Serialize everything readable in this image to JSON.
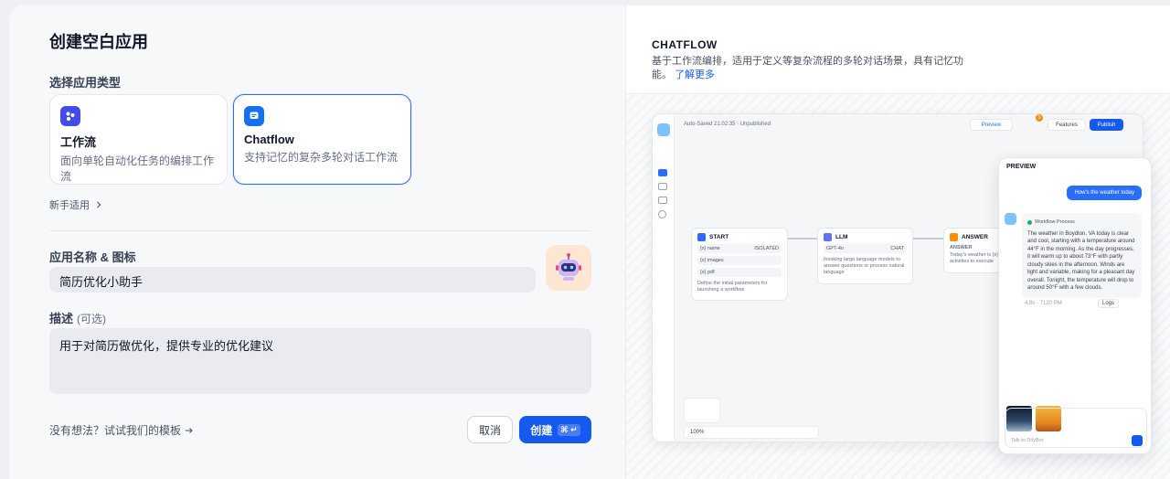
{
  "dialog": {
    "title": "创建空白应用",
    "type_label": "选择应用类型",
    "types": [
      {
        "title": "工作流",
        "desc": "面向单轮自动化任务的编排工作流"
      },
      {
        "title": "Chatflow",
        "desc": "支持记忆的复杂多轮对话工作流"
      }
    ],
    "newbie_link": "新手适用",
    "name_label": "应用名称 & 图标",
    "name_value": "简历优化小助手",
    "desc_label": "描述",
    "desc_optional": "(可选)",
    "desc_value": "用于对简历做优化，提供专业的优化建议",
    "template_link": "没有想法？试试我们的模板",
    "cancel_label": "取消",
    "create_label": "创建",
    "create_shortcut": "⌘ ↵"
  },
  "info": {
    "title": "CHATFLOW",
    "desc": "基于工作流编排，适用于定义等复杂流程的多轮对话场景，具有记忆功能。",
    "learn_more": "了解更多"
  },
  "mock": {
    "autosave": "Auto-Saved 21:02:35 · Unpublished",
    "preview_btn": "Preview",
    "features_btn": "Features",
    "publish_btn": "Publish",
    "badge": "3",
    "start": {
      "title": "START",
      "vars": [
        {
          "name": "{x} name",
          "type": "ISOLATED"
        },
        {
          "name": "{x} images",
          "type": ""
        },
        {
          "name": "{x} pdf",
          "type": ""
        }
      ],
      "desc": "Define the initial parameters for launching a workflow"
    },
    "llm": {
      "title": "LLM",
      "model": "GPT-4o",
      "mode": "CHAT",
      "desc": "Invoking large language models to answer questions or process natural language"
    },
    "answer": {
      "title": "ANSWER",
      "sub": "ANSWER",
      "text": "Today's weather is {x} · activities to execute"
    },
    "zoom": "100%",
    "preview": {
      "title": "PREVIEW",
      "user_msg": "How's the weather today",
      "process": "Workflow Process",
      "answer": "The weather in Boydton, VA today is clear and cool, starting with a temperature around 44°F in the morning. As the day progresses, it will warm up to about 73°F with partly cloudy skies in the afternoon. Winds are light and variable, making for a pleasant day overall. Tonight, the temperature will drop to around 50°F with a few clouds.",
      "meta": "4.8s · 7120 PM",
      "logs": "Logs",
      "input_placeholder": "Talk to DifyBot"
    }
  },
  "colors": {
    "primary": "#155aef",
    "workflow_icon": "#444ce7",
    "chatflow_icon": "#1570ef"
  }
}
